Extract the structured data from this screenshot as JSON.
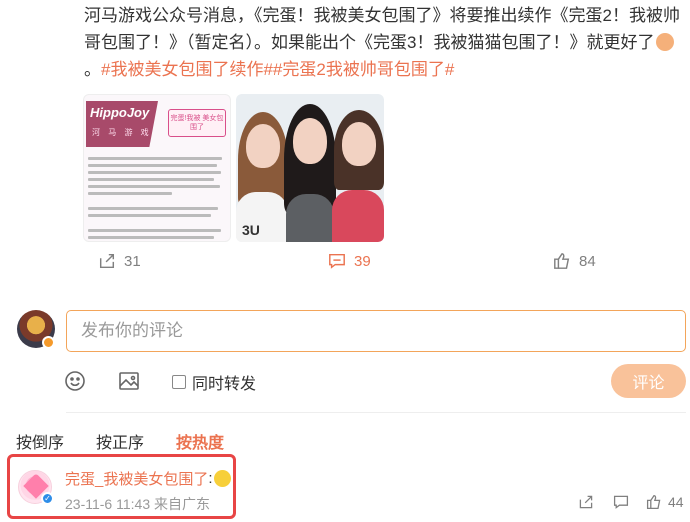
{
  "post": {
    "text_part1": "河马游戏公众号消息，《完蛋！我被美女包围了》将要推出续作《完蛋2！我被帅哥包围了！》（暂定名）。如果能出个《完蛋3！我被猫猫包围了！》就更好了",
    "text_part2": "。",
    "tags": "#我被美女包围了续作##完蛋2我被帅哥包围了#",
    "emoji_icon": "clapping-hands-emoji"
  },
  "images": {
    "card1": {
      "logo": "HippoJoy",
      "sub": "河 马 游 戏",
      "bubble": "完蛋!我被\n美女包围了"
    },
    "card2": {
      "shirt_text": "3U"
    }
  },
  "actions": {
    "repost_count": "31",
    "comment_count": "39",
    "like_count": "84",
    "active_color": "#eb7350"
  },
  "composer": {
    "placeholder": "发布你的评论",
    "repost_label": "同时转发",
    "submit_label": "评论"
  },
  "sort": {
    "tabs": [
      "按倒序",
      "按正序",
      "按热度"
    ],
    "active_index": 2
  },
  "comment": {
    "username": "完蛋_我被美女包围了",
    "colon": ":",
    "time": "23-11-6 11:43",
    "location": "来自广东",
    "like_count": "44",
    "highlight_color": "#e84545"
  }
}
